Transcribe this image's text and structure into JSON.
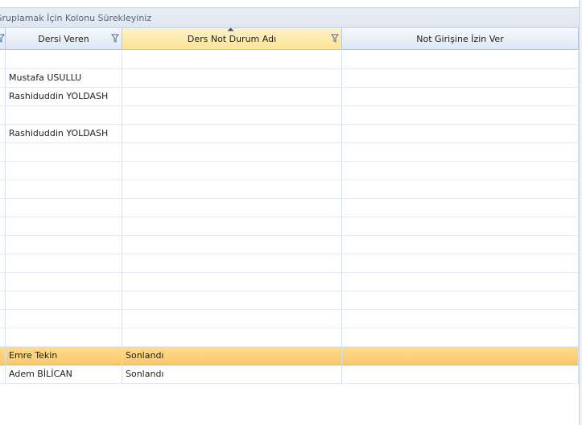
{
  "group_panel": {
    "text": "Gruplamak İçin Kolonu Sürekleyiniz"
  },
  "columns": [
    {
      "label": ""
    },
    {
      "label": "Dersi Veren"
    },
    {
      "label": "Ders Not Durum Adı"
    },
    {
      "label": "Not Girişine İzin Ver"
    }
  ],
  "sorted_column": "Ders Not Durum Adı",
  "rows": [
    {
      "teacher": "",
      "status": "",
      "allow": ""
    },
    {
      "teacher": "Mustafa USULLU",
      "status": "",
      "allow": ""
    },
    {
      "teacher": "Rashiduddin YOLDASH",
      "status": "",
      "allow": ""
    },
    {
      "teacher": "",
      "status": "",
      "allow": ""
    },
    {
      "teacher": "Rashiduddin YOLDASH",
      "status": "",
      "allow": ""
    },
    {
      "teacher": "",
      "status": "",
      "allow": ""
    },
    {
      "teacher": "",
      "status": "",
      "allow": ""
    },
    {
      "teacher": "",
      "status": "",
      "allow": ""
    },
    {
      "teacher": "",
      "status": "",
      "allow": ""
    },
    {
      "teacher": "",
      "status": "",
      "allow": ""
    },
    {
      "teacher": "",
      "status": "",
      "allow": ""
    },
    {
      "teacher": "",
      "status": "",
      "allow": ""
    },
    {
      "teacher": "",
      "status": "",
      "allow": ""
    },
    {
      "teacher": "",
      "status": "",
      "allow": ""
    },
    {
      "teacher": "",
      "status": "",
      "allow": ""
    },
    {
      "teacher": "",
      "status": "",
      "allow": ""
    },
    {
      "teacher": "Emre Tekin",
      "status": "Sonlandı",
      "allow": ""
    },
    {
      "teacher": "Adem BİLİCAN",
      "status": "Sonlandı",
      "allow": ""
    }
  ],
  "selected_row": 16,
  "colors": {
    "header": "#dde7f4",
    "active_header": "#fde497",
    "selected_row": "#fbc86a",
    "grid_line": "#d6e1ee"
  },
  "icons": {
    "filter": "filter-icon",
    "sort": "sort-ascending-icon"
  }
}
